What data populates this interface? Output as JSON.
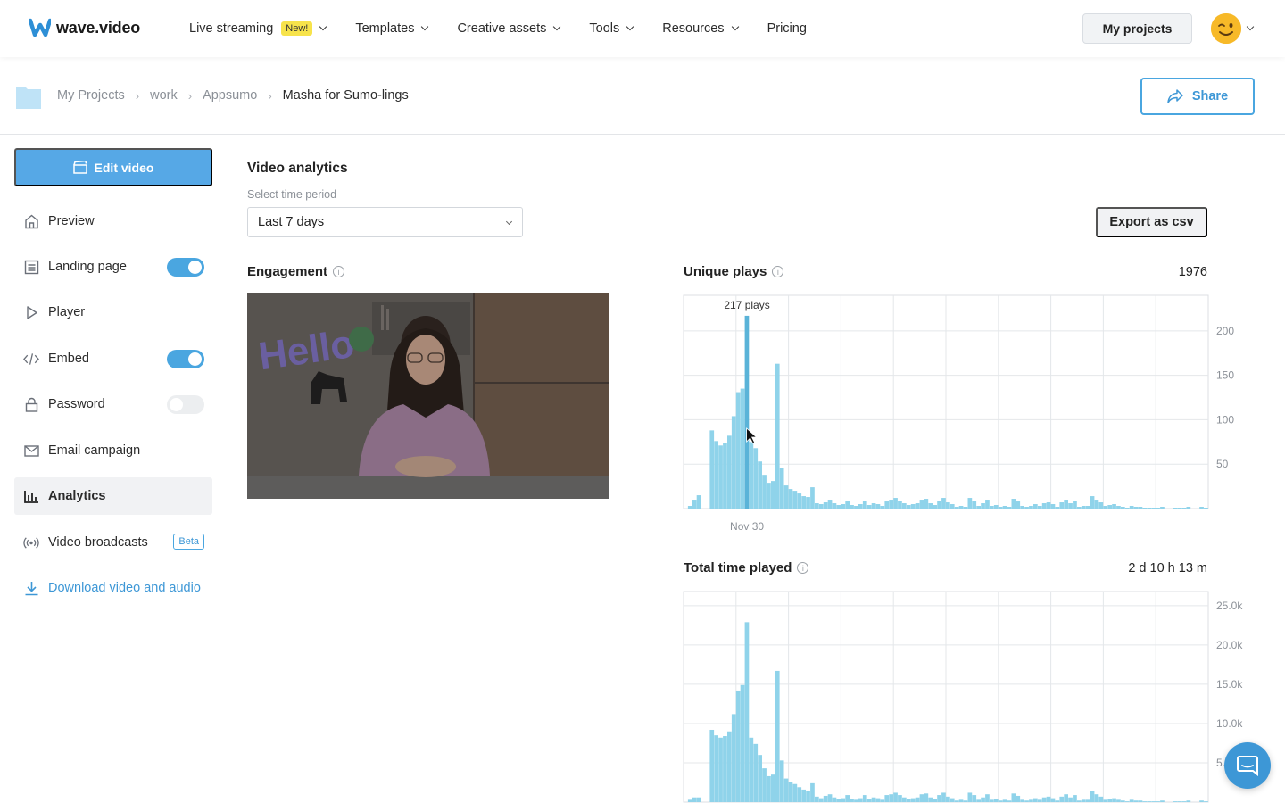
{
  "brand": {
    "name": "wave.video"
  },
  "nav": {
    "items": [
      {
        "label": "Live streaming",
        "badge": "New!",
        "has_dropdown": true
      },
      {
        "label": "Templates",
        "has_dropdown": true
      },
      {
        "label": "Creative assets",
        "has_dropdown": true
      },
      {
        "label": "Tools",
        "has_dropdown": true
      },
      {
        "label": "Resources",
        "has_dropdown": true
      },
      {
        "label": "Pricing",
        "has_dropdown": false
      }
    ],
    "my_projects": "My projects"
  },
  "breadcrumb": {
    "items": [
      "My Projects",
      "work",
      "Appsumo",
      "Masha for Sumo-lings"
    ],
    "share": "Share"
  },
  "sidebar": {
    "edit_video": "Edit video",
    "items": [
      {
        "label": "Preview",
        "icon": "home-icon"
      },
      {
        "label": "Landing page",
        "icon": "layout-icon",
        "toggle": "on"
      },
      {
        "label": "Player",
        "icon": "play-icon"
      },
      {
        "label": "Embed",
        "icon": "code-icon",
        "toggle": "on"
      },
      {
        "label": "Password",
        "icon": "lock-icon",
        "toggle": "off"
      },
      {
        "label": "Email campaign",
        "icon": "mail-icon"
      },
      {
        "label": "Analytics",
        "icon": "bar-chart-icon",
        "active": true
      },
      {
        "label": "Video broadcasts",
        "icon": "broadcast-icon",
        "badge": "Beta"
      },
      {
        "label": "Download video and audio",
        "icon": "download-icon",
        "link": true
      }
    ]
  },
  "analytics": {
    "title": "Video analytics",
    "period_label": "Select time period",
    "period_value": "Last 7 days",
    "export": "Export as csv",
    "engagement": {
      "title": "Engagement",
      "thumbnail_text": "Hello"
    },
    "unique_plays": {
      "title": "Unique plays",
      "total": "1976",
      "tooltip": "217 plays",
      "x_tick": "Nov 30"
    },
    "total_time": {
      "title": "Total time played",
      "total": "2 d 10 h 13 m"
    }
  },
  "colors": {
    "accent": "#4aa6e0",
    "bar": "#8fd3ea",
    "highlight": "#5ab3d8"
  },
  "chart_data": [
    {
      "type": "bar",
      "title": "Unique plays",
      "x_tick_labels": [
        "Nov 30"
      ],
      "y_ticks": [
        50,
        100,
        150,
        200
      ],
      "ylim": [
        0,
        240
      ],
      "grid": true,
      "highlight_index": 14,
      "tooltip": "217 plays",
      "values": [
        0,
        3,
        10,
        15,
        0,
        0,
        88,
        76,
        71,
        74,
        82,
        104,
        131,
        135,
        217,
        75,
        68,
        53,
        38,
        29,
        31,
        163,
        46,
        26,
        22,
        20,
        17,
        14,
        13,
        24,
        6,
        5,
        7,
        10,
        6,
        4,
        5,
        8,
        4,
        3,
        5,
        9,
        4,
        6,
        5,
        3,
        8,
        10,
        12,
        9,
        6,
        4,
        5,
        6,
        10,
        11,
        6,
        4,
        9,
        12,
        7,
        5,
        2,
        3,
        2,
        12,
        9,
        3,
        6,
        10,
        3,
        4,
        2,
        3,
        2,
        11,
        8,
        3,
        2,
        3,
        5,
        3,
        6,
        7,
        5,
        2,
        7,
        10,
        6,
        9,
        2,
        3,
        3,
        14,
        10,
        7,
        3,
        4,
        5,
        3,
        2,
        1,
        3,
        2,
        2,
        1,
        1,
        1,
        1,
        2,
        0,
        0,
        1,
        1,
        1,
        2,
        0,
        0,
        2,
        1
      ]
    },
    {
      "type": "bar",
      "title": "Total time played",
      "y_ticks": [
        "25.0k",
        "20.0k",
        "15.0k",
        "10.0k",
        "5.0k"
      ],
      "ylim": [
        0,
        26800
      ],
      "grid": true,
      "values": [
        0,
        300,
        600,
        600,
        0,
        0,
        9200,
        8500,
        8200,
        8400,
        9000,
        11200,
        14200,
        14900,
        22900,
        8200,
        7400,
        6000,
        4300,
        3300,
        3500,
        16700,
        5300,
        3000,
        2500,
        2300,
        1900,
        1600,
        1400,
        2400,
        700,
        500,
        800,
        1000,
        600,
        400,
        500,
        900,
        400,
        300,
        500,
        900,
        400,
        600,
        500,
        300,
        900,
        1000,
        1200,
        900,
        600,
        400,
        500,
        600,
        1000,
        1100,
        600,
        400,
        900,
        1200,
        700,
        500,
        200,
        300,
        200,
        1200,
        900,
        300,
        600,
        1000,
        300,
        400,
        200,
        300,
        200,
        1100,
        800,
        300,
        200,
        300,
        500,
        300,
        600,
        700,
        500,
        200,
        700,
        1000,
        600,
        900,
        200,
        300,
        300,
        1400,
        1000,
        700,
        300,
        400,
        500,
        300,
        200,
        100,
        300,
        200,
        200,
        100,
        100,
        100,
        100,
        200,
        0,
        0,
        100,
        100,
        100,
        200,
        0,
        0,
        200,
        100
      ]
    }
  ]
}
